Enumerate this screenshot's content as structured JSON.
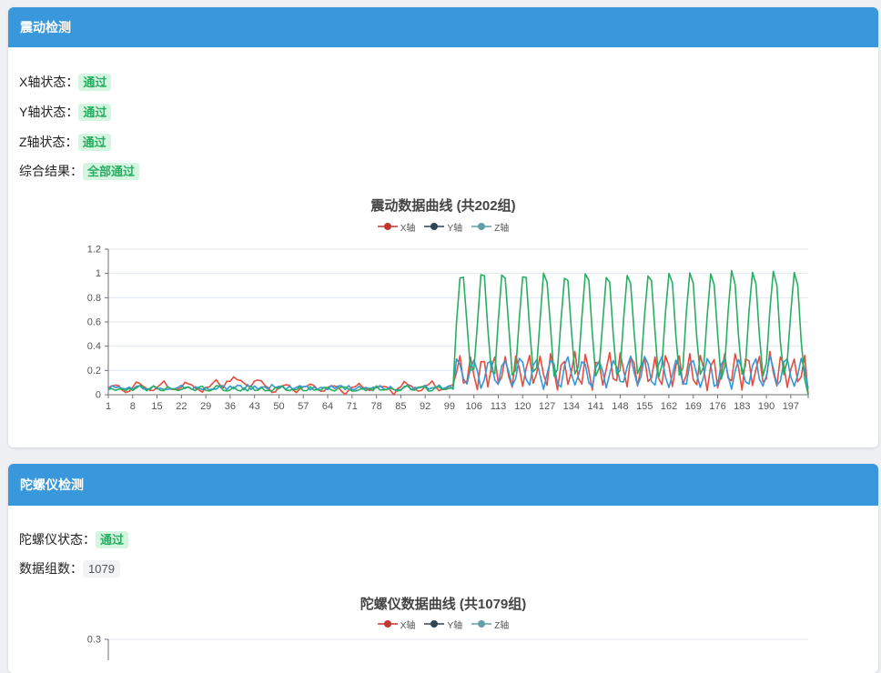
{
  "vibration": {
    "header": "震动检测",
    "x_label": "X轴状态：",
    "x_status": "通过",
    "y_label": "Y轴状态：",
    "y_status": "通过",
    "z_label": "Z轴状态：",
    "z_status": "通过",
    "overall_label": "综合结果：",
    "overall_status": "全部通过"
  },
  "gyro": {
    "header": "陀螺仪检测",
    "status_label": "陀螺仪状态：",
    "status": "通过",
    "count_label": "数据组数：",
    "count": "1079"
  },
  "colors": {
    "header": "#3898db",
    "pass_bg": "#d5f5e0",
    "pass_text": "#27ae60"
  },
  "chart_data": [
    {
      "type": "line",
      "title": "震动数据曲线 (共202组)",
      "legend": [
        "X轴",
        "Y轴",
        "Z轴"
      ],
      "legend_colors": [
        "#c23531",
        "#2f4554",
        "#61a0a8"
      ],
      "series_colors": [
        "#e74c3c",
        "#3498db",
        "#27ae60"
      ],
      "x_ticks": [
        "1",
        "8",
        "15",
        "22",
        "29",
        "36",
        "43",
        "50",
        "57",
        "64",
        "71",
        "78",
        "85",
        "92",
        "99",
        "106",
        "113",
        "120",
        "127",
        "134",
        "141",
        "148",
        "155",
        "162",
        "169",
        "176",
        "183",
        "190",
        "197"
      ],
      "y_ticks": [
        "0",
        "0.2",
        "0.4",
        "0.6",
        "0.8",
        "1",
        "1.2"
      ],
      "ylim": [
        0,
        1.2
      ],
      "n_points": 202,
      "series": [
        {
          "name": "X轴",
          "values": []
        },
        {
          "name": "Y轴",
          "values": []
        },
        {
          "name": "Z轴",
          "values": []
        }
      ]
    },
    {
      "type": "line",
      "title": "陀螺仪数据曲线 (共1079组)",
      "legend": [
        "X轴",
        "Y轴",
        "Z轴"
      ],
      "legend_colors": [
        "#c23531",
        "#2f4554",
        "#61a0a8"
      ],
      "y_ticks": [
        "0.3"
      ]
    }
  ]
}
